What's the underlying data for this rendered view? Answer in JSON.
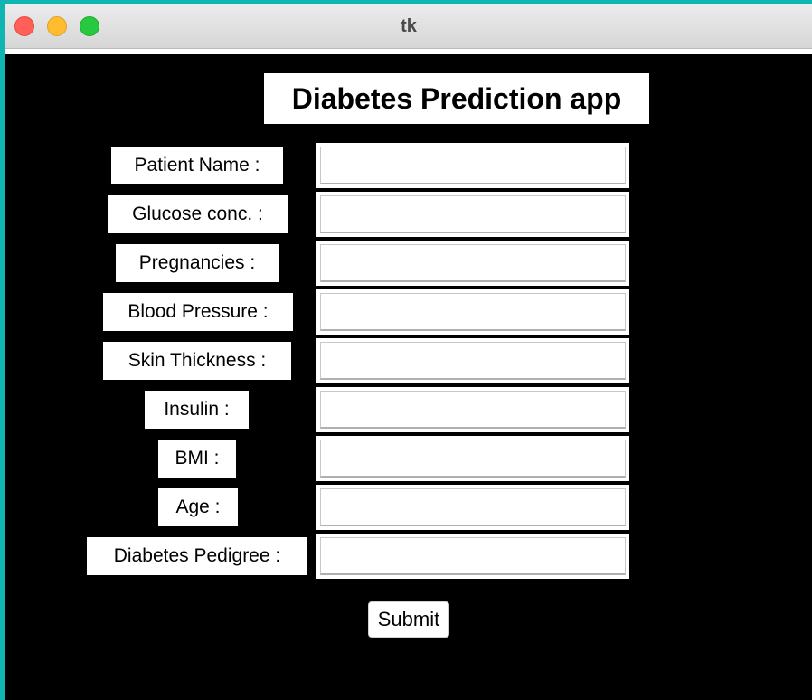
{
  "window": {
    "title": "tk"
  },
  "form": {
    "heading": "Diabetes Prediction app",
    "fields": [
      {
        "label": "Patient Name :",
        "value": ""
      },
      {
        "label": "Glucose conc. :",
        "value": ""
      },
      {
        "label": "Pregnancies :",
        "value": ""
      },
      {
        "label": "Blood Pressure :",
        "value": ""
      },
      {
        "label": "Skin Thickness :",
        "value": ""
      },
      {
        "label": "Insulin :",
        "value": ""
      },
      {
        "label": "BMI :",
        "value": ""
      },
      {
        "label": "Age :",
        "value": ""
      },
      {
        "label": "Diabetes Pedigree :",
        "value": ""
      }
    ],
    "submit_label": "Submit"
  },
  "colors": {
    "background": "#000000",
    "label_background": "#ffffff",
    "desktop": "#0fb5b0"
  }
}
